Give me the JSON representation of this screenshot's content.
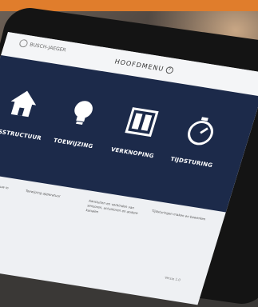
{
  "brand": {
    "name": "BUSCH-JAEGER"
  },
  "header": {
    "title": "HOOFDMENU",
    "help_icon": "help-icon"
  },
  "tiles": [
    {
      "label": "HUISSTRUCTUUR",
      "icon": "house-icon",
      "desc": "Indelen van het gebouw in"
    },
    {
      "label": "TOEWIJZING",
      "icon": "lightbulb-icon",
      "desc": "Toewijzing apparatuur"
    },
    {
      "label": "VERKNOPING",
      "icon": "switch-icon",
      "desc": "Aansluiten en verbinden van sensoren, actuatoren en andere kanalen"
    },
    {
      "label": "TIJDSTURING",
      "icon": "timer-icon",
      "desc": "Tijdsturingen maken en bewerken"
    }
  ],
  "footer": {
    "text": "Versie 1.0"
  }
}
